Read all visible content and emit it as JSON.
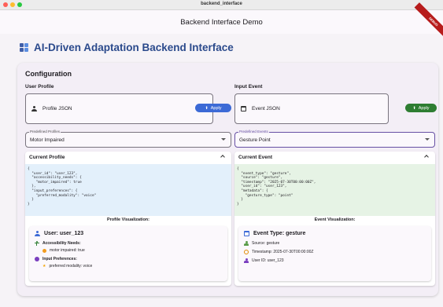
{
  "window": {
    "title": "backend_interface"
  },
  "appbar": {
    "title": "Backend Interface Demo",
    "debug_banner": "DEBUG"
  },
  "page": {
    "title": "AI-Driven Adaptation Backend Interface"
  },
  "configuration": {
    "title": "Configuration",
    "profile": {
      "section_label": "User Profile",
      "json_field_label": "Profile JSON",
      "apply_label": "Apply",
      "select_label": "Predefined Profiles",
      "select_value": "Motor Impaired",
      "panel_title": "Current Profile",
      "code_lines": "{\n  \"user_id\": \"user_123\",\n  \"accessibility_needs\": {\n    \"motor_impaired\": true\n  },\n  \"input_preferences\": {\n    \"preferred_modality\": \"voice\"\n  }\n}",
      "viz_title": "Profile Visualization:",
      "viz_user": "User: user_123",
      "viz_access_title": "Accessibility Needs:",
      "viz_access_item": "motor impaired: true",
      "viz_input_title": "Input Preferences:",
      "viz_input_item": "preferred modality: voice"
    },
    "event": {
      "section_label": "Input Event",
      "json_field_label": "Event JSON",
      "apply_label": "Apply",
      "select_label": "Predefined Events",
      "select_value": "Gesture Point",
      "panel_title": "Current Event",
      "code_lines": "{\n  \"event_type\": \"gesture\",\n  \"source\": \"gesture\",\n  \"timestamp\": \"2025-07-30T00:00:00Z\",\n  \"user_id\": \"user_123\",\n  \"metadata\": {\n    \"gesture_type\": \"point\"\n  }\n}",
      "viz_title": "Event Visualization:",
      "viz_type": "Event Type: gesture",
      "viz_source": "Source: gesture",
      "viz_timestamp": "Timestamp: 2025-07-30T00:00:00Z",
      "viz_user": "User ID: user_123"
    }
  },
  "colors": {
    "accent": "#2b4a8c",
    "apply_blue": "#3c6ad6",
    "apply_green": "#2e7d32",
    "focus": "#6750a4"
  }
}
